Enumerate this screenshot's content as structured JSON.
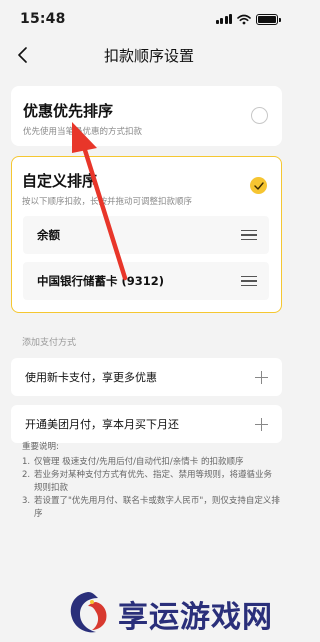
{
  "status_bar": {
    "time": "15:48"
  },
  "nav": {
    "title": "扣款顺序设置"
  },
  "preferential": {
    "title": "优惠优先排序",
    "subtitle": "优先使用当笔最优惠的方式扣款",
    "selected": false
  },
  "custom": {
    "title": "自定义排序",
    "subtitle": "按以下顺序扣款，长按并拖动可调整扣款顺序",
    "selected": true,
    "items": [
      {
        "label": "余额"
      },
      {
        "label": "中国银行储蓄卡 (9312)"
      }
    ]
  },
  "add_payment": {
    "section_label": "添加支付方式",
    "rows": [
      {
        "label": "使用新卡支付，享更多优惠"
      },
      {
        "label": "开通美团月付，享本月买下月还"
      }
    ]
  },
  "notes": {
    "title": "重要说明:",
    "items": [
      {
        "num": "1.",
        "text": "仅管理 极速支付/先用后付/自动代扣/亲情卡 的扣款顺序"
      },
      {
        "num": "2.",
        "text": "若业务对某种支付方式有优先、指定、禁用等规则，将遵循业务规则扣款"
      },
      {
        "num": "3.",
        "text": "若设置了\"优先用月付、联名卡或数字人民币\"，则仅支持自定义排序"
      }
    ]
  },
  "watermark": {
    "text": "享运游戏网"
  },
  "colors": {
    "accent": "#f6c531",
    "background": "#f3f3f3",
    "annotation_arrow": "#e8362a"
  }
}
